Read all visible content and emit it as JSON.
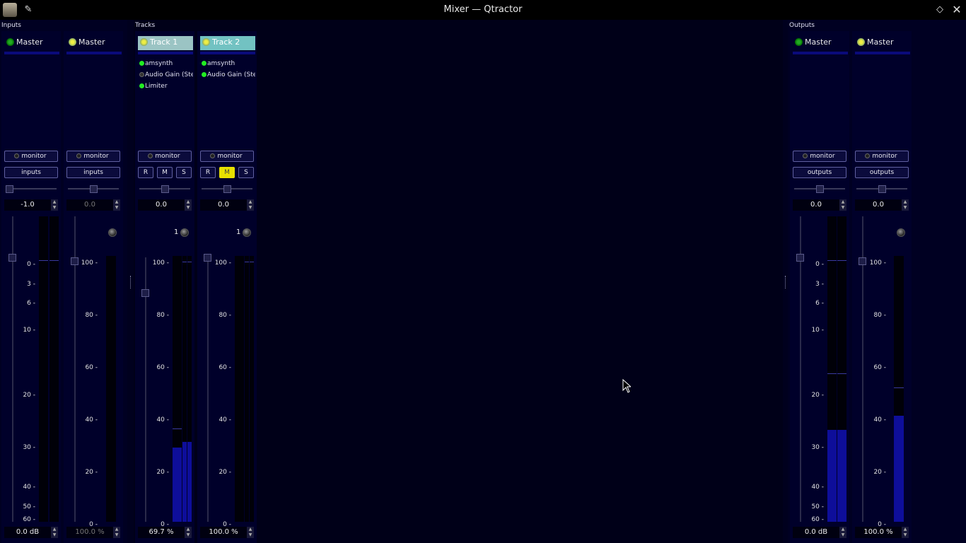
{
  "window": {
    "title": "Mixer — Qtractor"
  },
  "sections": {
    "inputs": "Inputs",
    "tracks": "Tracks",
    "outputs": "Outputs"
  },
  "inputs": [
    {
      "name": "Master",
      "type": "audio",
      "monitor": "monitor",
      "route": "inputs",
      "gain": "-1.0",
      "bottom": "0.0 dB"
    },
    {
      "name": "Master",
      "type": "midi",
      "monitor": "monitor",
      "route": "inputs",
      "gain": "0.0",
      "bottom": "100.0 %"
    }
  ],
  "tracks": [
    {
      "name": "Track 1",
      "plugins": [
        "amsynth",
        "Audio Gain (Ste",
        "Limiter"
      ],
      "monitor": "monitor",
      "r": "R",
      "m": "M",
      "s": "S",
      "gain": "0.0",
      "channel": "1",
      "bottom": "69.7 %"
    },
    {
      "name": "Track 2",
      "plugins": [
        "amsynth",
        "Audio Gain (Ste"
      ],
      "monitor": "monitor",
      "r": "R",
      "m": "M",
      "s": "S",
      "gain": "0.0",
      "channel": "1",
      "bottom": "100.0 %"
    }
  ],
  "outputs": [
    {
      "name": "Master",
      "type": "audio",
      "monitor": "monitor",
      "route": "outputs",
      "gain": "0.0",
      "bottom": "0.0 dB"
    },
    {
      "name": "Master",
      "type": "midi",
      "monitor": "monitor",
      "route": "outputs",
      "gain": "0.0",
      "bottom": "100.0 %"
    }
  ],
  "scales": {
    "db": [
      "0",
      "3",
      "6",
      "10",
      "20",
      "30",
      "40",
      "50",
      "60"
    ],
    "pct": [
      "100",
      "80",
      "60",
      "40",
      "20",
      "0"
    ]
  },
  "levels": {
    "track1_fader": 0.697,
    "track2_fader": 1.0,
    "track1_meter": [
      0.28,
      0.3,
      0.3
    ],
    "out_audio_meter": [
      0.3,
      0.3
    ],
    "out_midi_meter": 0.4
  },
  "colors": {
    "accent_meter": "#0e0e9a",
    "plugin_on": "#22ee22",
    "mute_active": "#e8e000"
  }
}
